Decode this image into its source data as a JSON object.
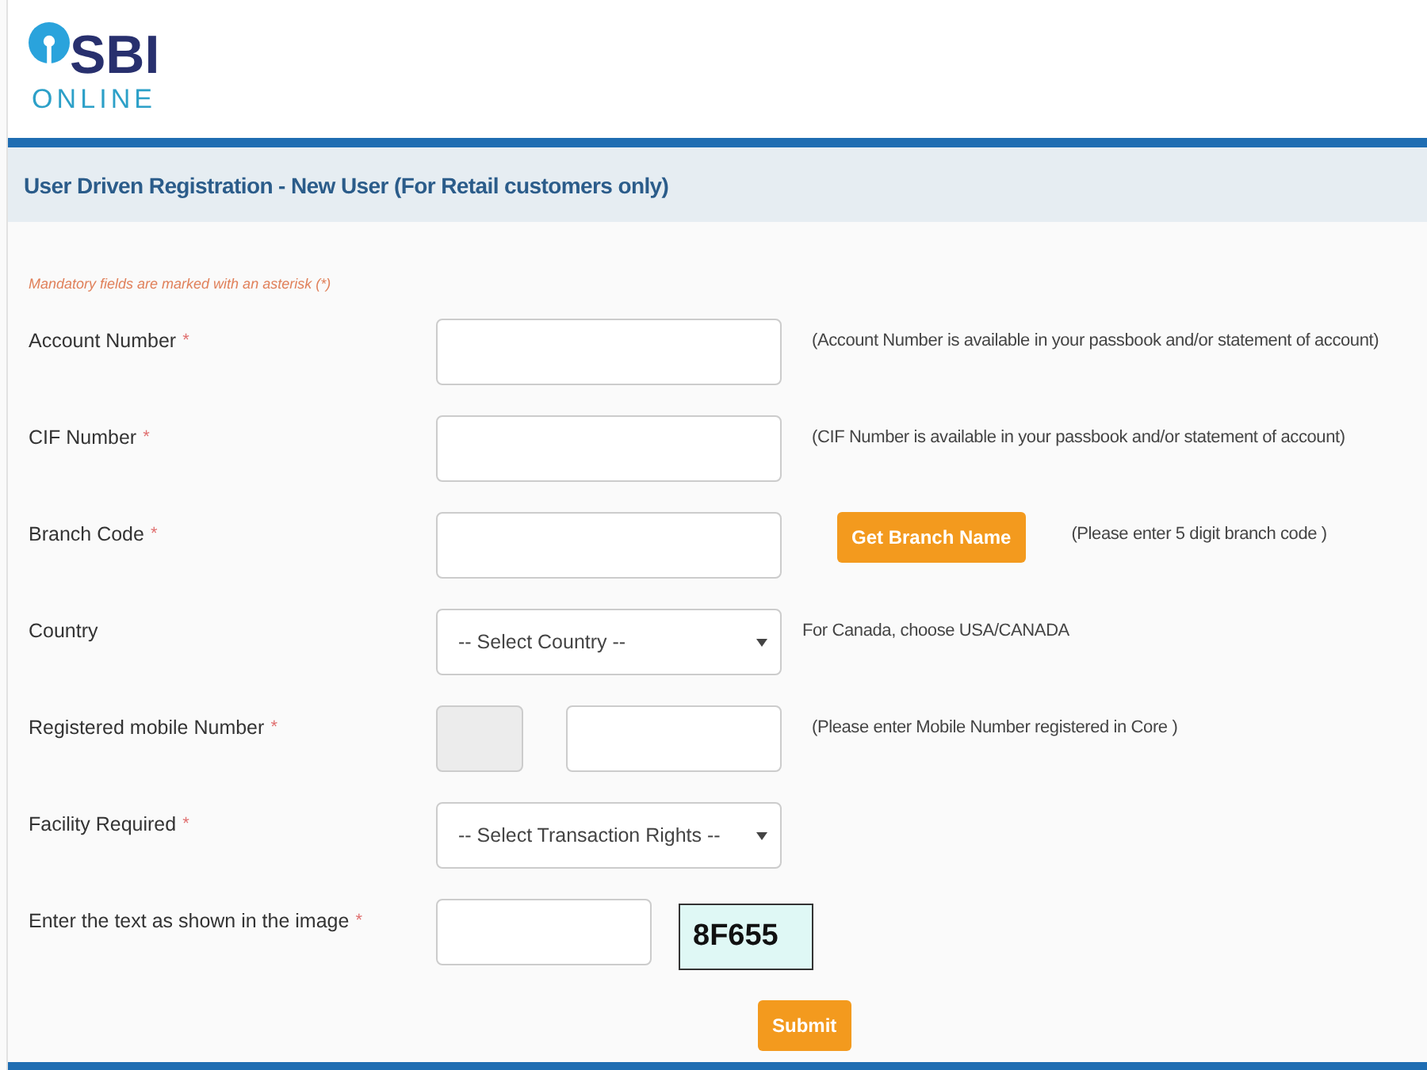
{
  "logo": {
    "brand": "SBI",
    "tagline": "ONLINE"
  },
  "page_title": "User Driven Registration - New User (For Retail customers only)",
  "note": "Mandatory fields are marked with an asterisk (*)",
  "rows": [
    {
      "kind": "text",
      "label": "Account Number",
      "mark": "*",
      "help": "(Account Number is available in your passbook and/or statement of account)"
    },
    {
      "kind": "text",
      "label": "CIF Number",
      "mark": "*",
      "help": "(CIF Number is available in your passbook and/or statement of account)"
    },
    {
      "kind": "text_button",
      "label": "Branch Code",
      "mark": "*",
      "button": "Get Branch Name",
      "help": "(Please enter 5 digit branch code )"
    },
    {
      "kind": "select",
      "label": "Country",
      "value": "-- Select Country --",
      "help": "For Canada, choose USA/CANADA"
    },
    {
      "kind": "mobile",
      "label": "Registered mobile Number",
      "mark": "*",
      "code_disabled": true,
      "help": "(Please enter Mobile Number registered in Core )"
    },
    {
      "kind": "select",
      "label": "Facility Required",
      "mark": "*",
      "value": "-- Select Transaction Rights --"
    },
    {
      "kind": "captcha",
      "label": "Enter the text as shown in the image",
      "mark": "*",
      "captcha": "8F655"
    }
  ],
  "submit": "Submit"
}
